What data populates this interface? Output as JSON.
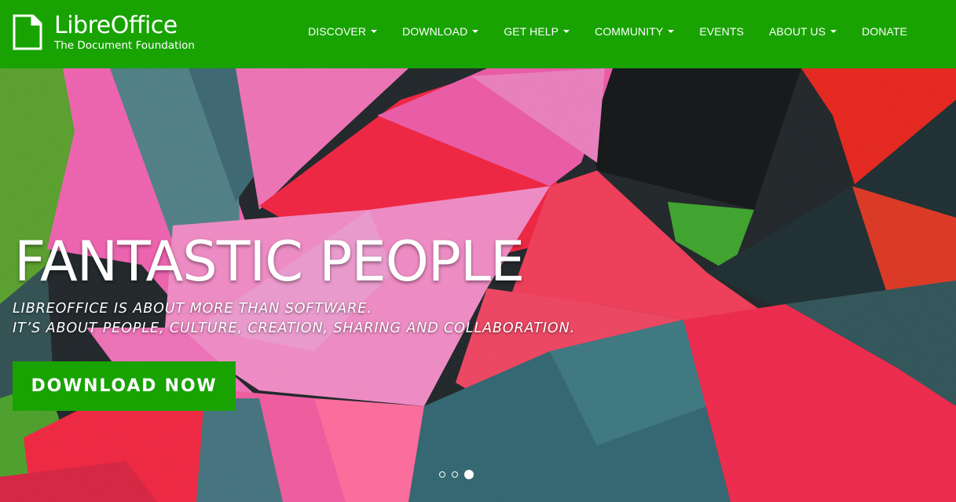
{
  "brand": {
    "name_bold": "Libre",
    "name_light": "Office",
    "subtitle": "The Document Foundation",
    "icon": "libreoffice-document-icon"
  },
  "nav": {
    "items": [
      {
        "label": "DISCOVER",
        "dropdown": true
      },
      {
        "label": "DOWNLOAD",
        "dropdown": true
      },
      {
        "label": "GET HELP",
        "dropdown": true
      },
      {
        "label": "COMMUNITY",
        "dropdown": true
      },
      {
        "label": "EVENTS",
        "dropdown": false
      },
      {
        "label": "ABOUT US",
        "dropdown": true
      },
      {
        "label": "DONATE",
        "dropdown": false
      }
    ]
  },
  "hero": {
    "title": "FANTASTIC PEOPLE",
    "subtitle_line1": "LIBREOFFICE IS ABOUT MORE THAN SOFTWARE.",
    "subtitle_line2": "IT’S ABOUT PEOPLE, CULTURE, CREATION, SHARING AND COLLABORATION.",
    "cta_label": "DOWNLOAD NOW",
    "slides_total": 3,
    "active_slide": 3
  },
  "colors": {
    "brand_green": "#18a303",
    "pink": "#f25ea5",
    "red": "#f2203f",
    "teal": "#3f6c75",
    "dark": "#1a1a1a"
  }
}
